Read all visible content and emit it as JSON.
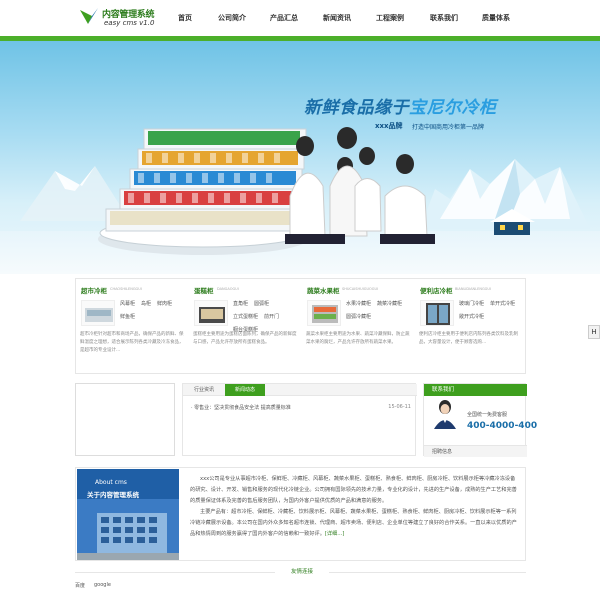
{
  "header": {
    "logo_title": "内容管理系统",
    "logo_sub": "easy cms   v1.0",
    "nav": [
      "首页",
      "公司简介",
      "产品汇总",
      "新闻资讯",
      "工程案例",
      "联系我们",
      "质量体系"
    ]
  },
  "banner": {
    "headline_a": "新鲜食品缘于",
    "headline_b": "宝尼尔冷柜",
    "brand": "xxx品牌",
    "slogan": "打造中国商用冷柜第一品牌"
  },
  "right_tab": "H",
  "products": [
    {
      "title": "超市冷柜",
      "pinyin": "CHAOSHILENGGUI",
      "links": [
        "风幕柜",
        "岛柜",
        "鲜肉柜",
        "鲜鱼柜"
      ],
      "desc": "超市冷柜针对超市和商场产品，确保产品的新鲜、保鲜温度之理想，适合展示陈列各类冷藏及冷冻食品，是超市的专业设计..."
    },
    {
      "title": "蛋糕柜",
      "pinyin": "DANGAOGUI",
      "links": [
        "直角柜",
        "圆弧柜",
        "立式蛋糕柜",
        "前开门",
        "橱台蛋糕柜"
      ],
      "desc": "蛋糕柜主要用途为蛋糕店面陈列，确保产品的新鲜度与口感，产品允许存放所有蛋糕食品。"
    },
    {
      "title": "蔬菜水果柜",
      "pinyin": "SHUCAISHUIGUOGUI",
      "links": [
        "水果冷藏柜",
        "蔬菜冷藏柜",
        "圆弧冷藏柜"
      ],
      "desc": "蔬菜水果柜主要用途为水果、蔬菜冷藏保鲜，防止蔬菜水果的腐烂，产品允许存放所有蔬菜水果。"
    },
    {
      "title": "便利店冷柜",
      "pinyin": "BIANLIDIANLENGGUI",
      "links": [
        "玻璃门冷柜",
        "单开式冷柜",
        "敞开式冷柜"
      ],
      "desc": "便利店冷柜主要用于便利店内陈列各类饮料及乳制品，大容量设计，便于顾客选购..."
    }
  ],
  "news": {
    "tab_inactive": "行业资讯",
    "tab_active": "新闻动态",
    "items": [
      {
        "title": "· 零售业：坚决贯彻食品安全法  提高质量标准",
        "date": "15-06-11"
      }
    ]
  },
  "contact": {
    "head": "联系我们",
    "label": "全国统一免费客服",
    "phone": "400-4000-400",
    "foot": "招聘信息"
  },
  "about": {
    "en": "About cms",
    "cn": "关于内容管理系统",
    "p1": "xxx公司是专业从事超市冷柜、保鲜柜、冷藏柜、风幕柜、蔬菜水果柜、蛋糕柜、熟食柜、鲜肉柜、厨房冷柜、饮料展示柜等冷藏冷冻设备的研究、设计、开发、销售和服务的现代化冷链企业。公司拥有国际领先的技术力量，专业化的设计，先进的生产设备，成熟的生产工艺和完善的质量保证体系及完善的售后服务团队，为国内外客户提供优质的产品和满意的服务。",
    "p2": "主要产品有：超市冷柜、保鲜柜、冷藏柜、饮料展示柜、风幕柜、蔬菜水果柜、蛋糕柜、熟食柜、鲜肉柜、厨房冷柜、饮料展示柜等一系列冷链冷藏展示设备。本公司在国内外众多知名超市连锁、代理商、超市卖场、便利店、企业单位等建立了良好的合作关系。一直以来以优质的产品和热情周到的服务赢得了国内外客户的信赖和一致好评。",
    "more": "[详细...]"
  },
  "links": {
    "title": "友情连接",
    "items": [
      "百度",
      "google"
    ]
  },
  "colors": {
    "accent_green": "#4caf2a",
    "dark_green": "#2e7d1e",
    "blue": "#1a6ea8"
  }
}
